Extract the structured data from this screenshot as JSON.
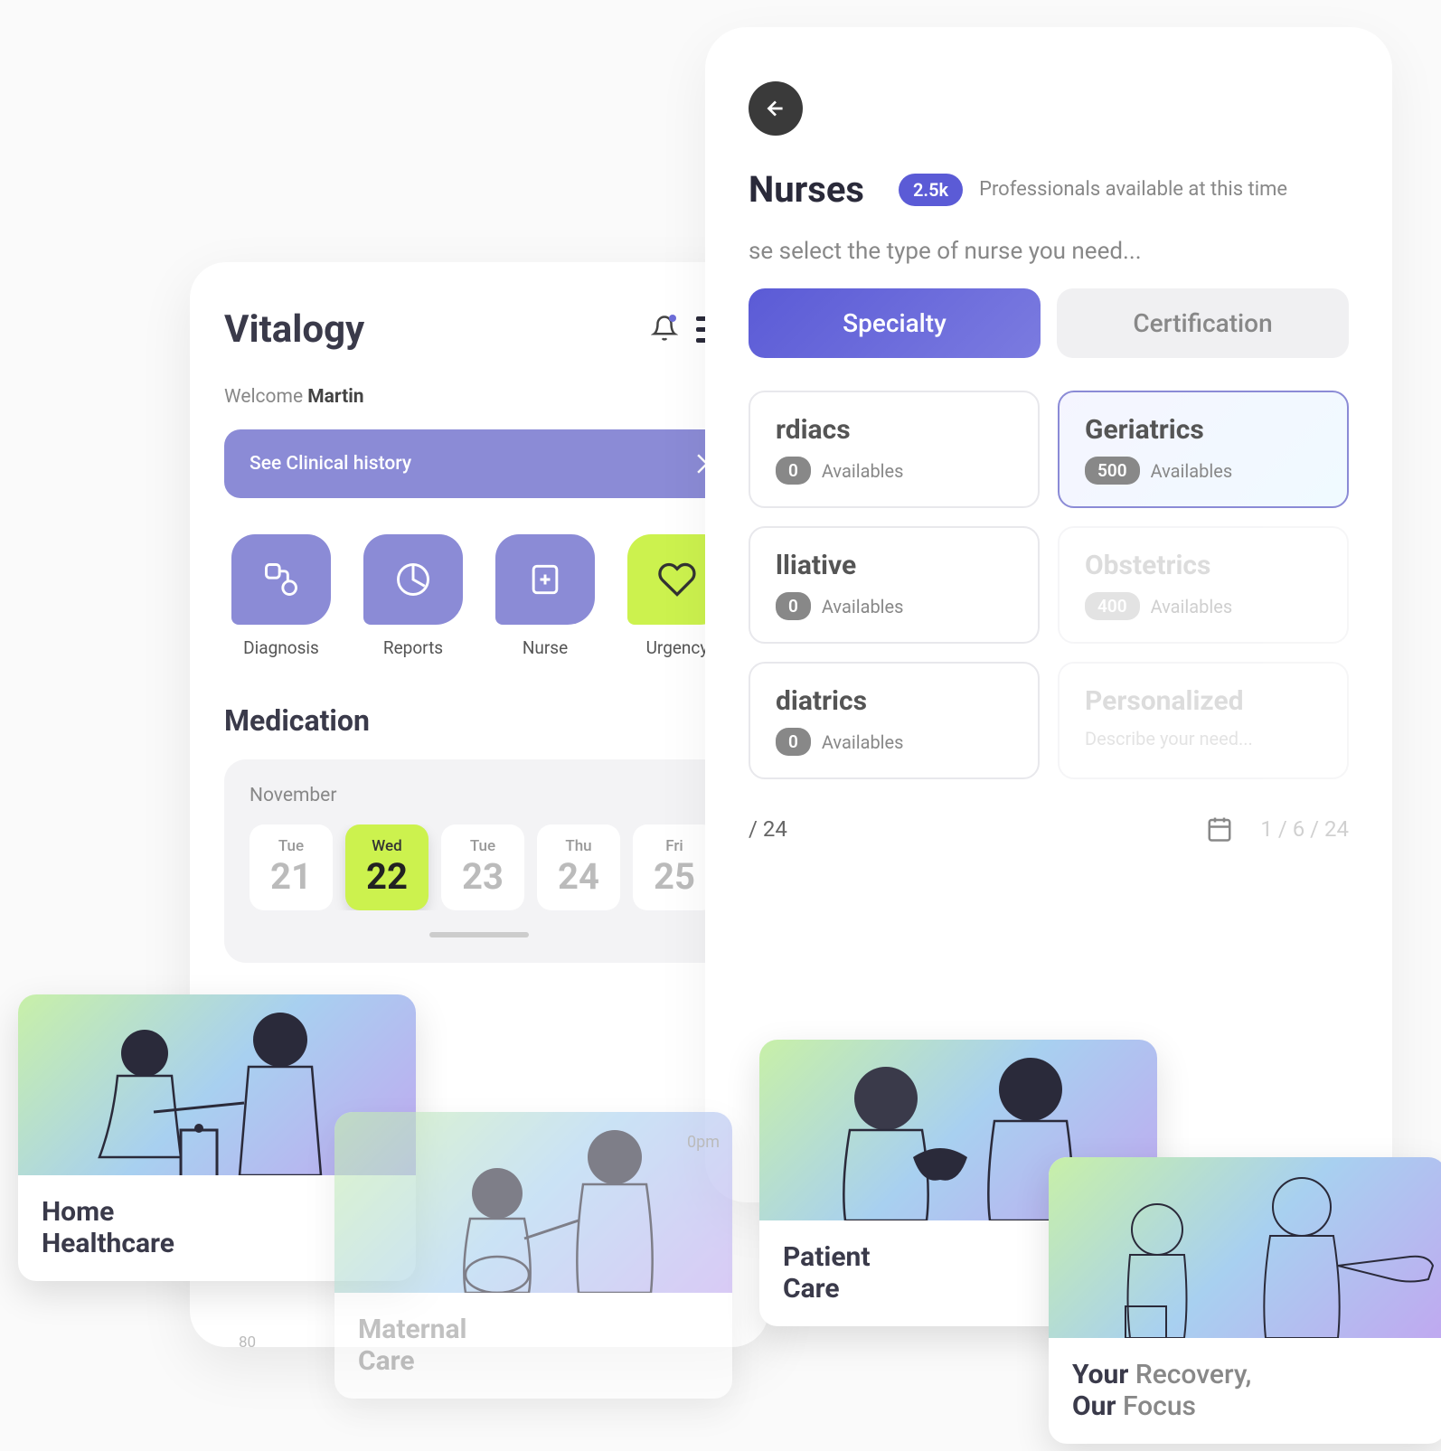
{
  "phone1": {
    "app_title": "Vitalogy",
    "welcome_prefix": "Welcome ",
    "welcome_name": "Martin",
    "history_button": "See Clinical history",
    "quick_actions": [
      {
        "label": "Diagnosis",
        "icon": "stethoscope",
        "color": "purple"
      },
      {
        "label": "Reports",
        "icon": "pie",
        "color": "purple"
      },
      {
        "label": "Nurse",
        "icon": "nurse",
        "color": "purple"
      },
      {
        "label": "Urgency",
        "icon": "heart",
        "color": "lime"
      }
    ],
    "medication_title": "Medication",
    "month": "November",
    "days": [
      {
        "name": "Tue",
        "num": "21",
        "active": false
      },
      {
        "name": "Wed",
        "num": "22",
        "active": true
      },
      {
        "name": "Tue",
        "num": "23",
        "active": false
      },
      {
        "name": "Thu",
        "num": "24",
        "active": false
      },
      {
        "name": "Fri",
        "num": "25",
        "active": false
      }
    ]
  },
  "phone2": {
    "title": "Nurses",
    "count_badge": "2.5k",
    "count_text": "Professionals available at this time",
    "prompt": "se select the type of nurse you need...",
    "tabs": [
      {
        "label": "Specialty",
        "active": true
      },
      {
        "label": "Certification",
        "active": false
      }
    ],
    "specialties": [
      {
        "title": "rdiacs",
        "count": "0",
        "avail": "Availables",
        "faded": false,
        "selected": false
      },
      {
        "title": "Geriatrics",
        "count": "500",
        "avail": "Availables",
        "faded": false,
        "selected": true
      },
      {
        "title": "lliative",
        "count": "0",
        "avail": "Availables",
        "faded": false,
        "selected": false
      },
      {
        "title": "Obstetrics",
        "count": "400",
        "avail": "Availables",
        "faded": true,
        "selected": false
      },
      {
        "title": "diatrics",
        "count": "0",
        "avail": "Availables",
        "faded": false,
        "selected": false
      },
      {
        "title": "Personalized",
        "desc": "Describe your need...",
        "faded": true,
        "selected": false
      }
    ],
    "date1": "/ 24",
    "date2": "1 / 6 / 24"
  },
  "cards": {
    "home": "Home<br>Healthcare",
    "maternal": "Maternal<br>Care",
    "patient": "Patient<br>Care",
    "recovery_your": "Your ",
    "recovery_rec": "Recovery,",
    "recovery_our": "Our ",
    "recovery_focus": "Focus"
  },
  "misc": {
    "bpm": "0pm",
    "axis_80": "80"
  }
}
